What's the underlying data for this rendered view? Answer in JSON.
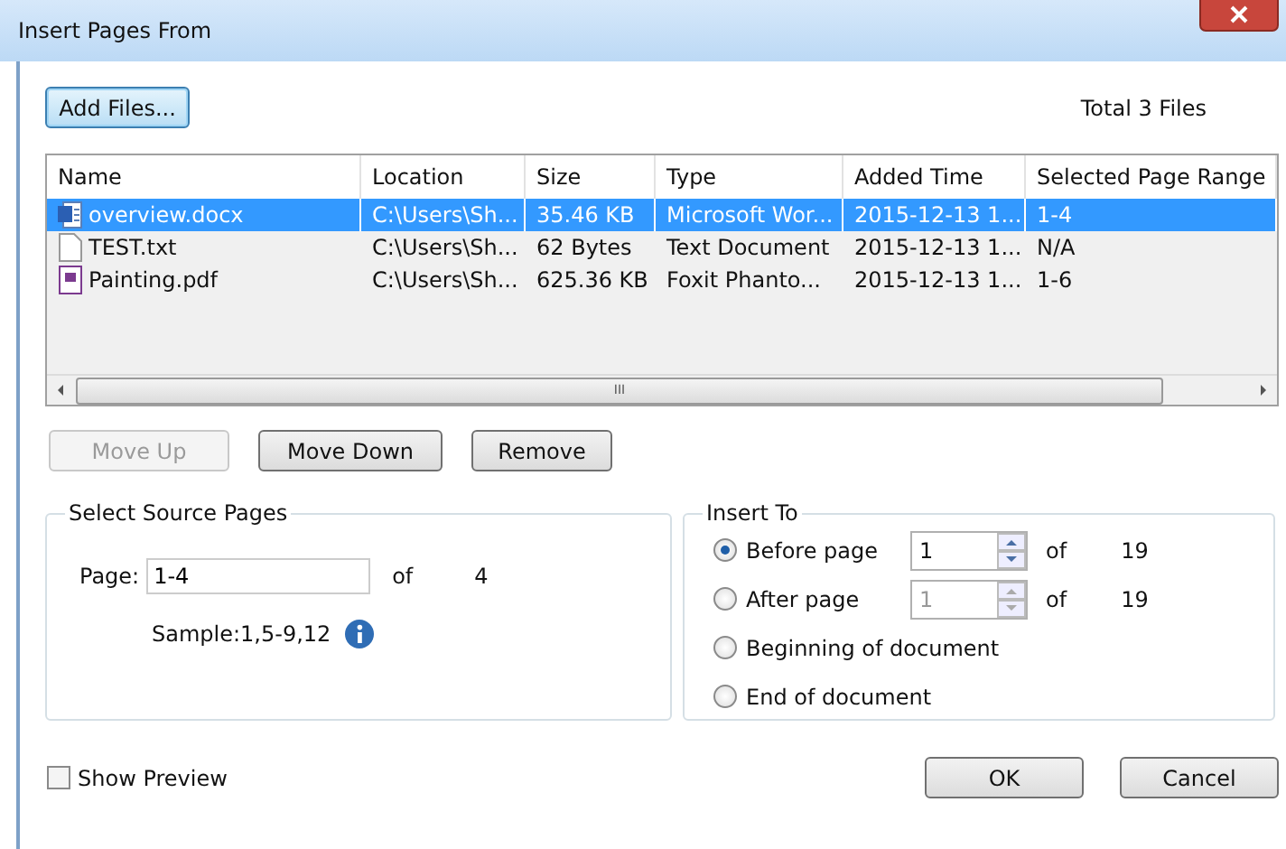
{
  "window": {
    "title": "Insert Pages From"
  },
  "add_files_button": "Add Files...",
  "total_files": "Total 3 Files",
  "table": {
    "columns": [
      "Name",
      "Location",
      "Size",
      "Type",
      "Added Time",
      "Selected Page Range"
    ],
    "rows": [
      {
        "kind": "word",
        "selected": true,
        "cells": [
          "overview.docx",
          "C:\\Users\\Sh...",
          "35.46 KB",
          "Microsoft Wor...",
          "2015-12-13 1...",
          "1-4"
        ]
      },
      {
        "kind": "text",
        "selected": false,
        "cells": [
          "TEST.txt",
          "C:\\Users\\Sh...",
          "62 Bytes",
          "Text Document",
          "2015-12-13 1...",
          "N/A"
        ]
      },
      {
        "kind": "pdf",
        "selected": false,
        "cells": [
          "Painting.pdf",
          "C:\\Users\\Sh...",
          "625.36 KB",
          "Foxit Phanto...",
          "2015-12-13 1...",
          "1-6"
        ]
      }
    ],
    "scroll_grip": "III"
  },
  "list_buttons": [
    {
      "label": "Move Up",
      "disabled": true
    },
    {
      "label": "Move Down",
      "disabled": false
    },
    {
      "label": "Remove",
      "disabled": false
    }
  ],
  "source_pages": {
    "title": "Select Source Pages",
    "label": "Page:",
    "value": "1-4",
    "of": "of",
    "total": "4",
    "sample": "Sample:1,5-9,12"
  },
  "insert_to": {
    "title": "Insert To",
    "options": [
      {
        "kind": "spin",
        "label": "Before page",
        "selected": true,
        "value": "1",
        "of": "of",
        "total": "19"
      },
      {
        "kind": "spin",
        "label": "After page",
        "selected": false,
        "value": "1",
        "of": "of",
        "total": "19"
      },
      {
        "kind": "plain",
        "label": "Beginning of document",
        "selected": false
      },
      {
        "kind": "plain",
        "label": "End of document",
        "selected": false
      }
    ]
  },
  "show_preview": {
    "label": "Show Preview",
    "checked": false
  },
  "buttons": [
    "OK",
    "Cancel"
  ]
}
